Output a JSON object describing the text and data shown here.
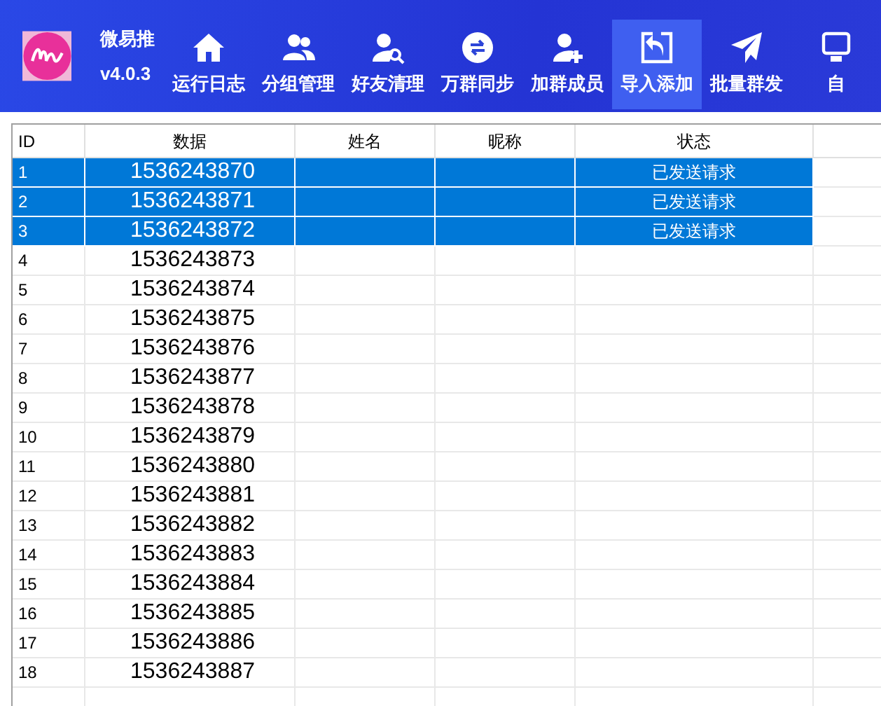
{
  "app": {
    "name": "微易推",
    "version": "v4.0.3"
  },
  "toolbar": [
    {
      "label": "运行日志",
      "selected": false
    },
    {
      "label": "分组管理",
      "selected": false
    },
    {
      "label": "好友清理",
      "selected": false
    },
    {
      "label": "万群同步",
      "selected": false
    },
    {
      "label": "加群成员",
      "selected": false
    },
    {
      "label": "导入添加",
      "selected": true
    },
    {
      "label": "批量群发",
      "selected": false
    },
    {
      "label": "自",
      "selected": false
    }
  ],
  "table": {
    "columns": [
      "ID",
      "数据",
      "姓名",
      "昵称",
      "状态"
    ],
    "rows": [
      {
        "id": "1",
        "data": "1536243870",
        "status": "已发送请求",
        "selected": true
      },
      {
        "id": "2",
        "data": "1536243871",
        "status": "已发送请求",
        "selected": true
      },
      {
        "id": "3",
        "data": "1536243872",
        "status": "已发送请求",
        "selected": true
      },
      {
        "id": "4",
        "data": "1536243873",
        "selected": false
      },
      {
        "id": "5",
        "data": "1536243874",
        "selected": false
      },
      {
        "id": "6",
        "data": "1536243875",
        "selected": false
      },
      {
        "id": "7",
        "data": "1536243876",
        "selected": false
      },
      {
        "id": "8",
        "data": "1536243877",
        "selected": false
      },
      {
        "id": "9",
        "data": "1536243878",
        "selected": false
      },
      {
        "id": "10",
        "data": "1536243879",
        "selected": false
      },
      {
        "id": "11",
        "data": "1536243880",
        "selected": false
      },
      {
        "id": "12",
        "data": "1536243881",
        "selected": false
      },
      {
        "id": "13",
        "data": "1536243882",
        "selected": false
      },
      {
        "id": "14",
        "data": "1536243883",
        "selected": false
      },
      {
        "id": "15",
        "data": "1536243884",
        "selected": false
      },
      {
        "id": "16",
        "data": "1536243885",
        "selected": false
      },
      {
        "id": "17",
        "data": "1536243886",
        "selected": false
      },
      {
        "id": "18",
        "data": "1536243887",
        "selected": false
      }
    ]
  }
}
